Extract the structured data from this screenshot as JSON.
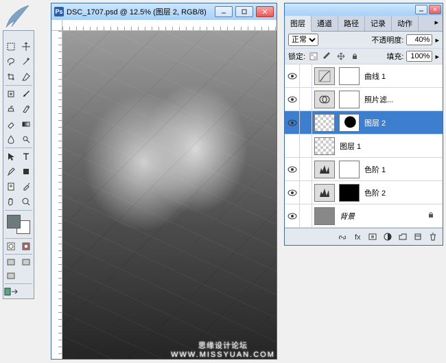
{
  "logo": {
    "alt": "feather"
  },
  "toolbox": {
    "tools": [
      "marquee",
      "move",
      "lasso",
      "magic-wand",
      "crop",
      "slice",
      "healing-brush",
      "brush",
      "clone-stamp",
      "history-brush",
      "eraser",
      "gradient",
      "blur",
      "dodge",
      "path-select",
      "type",
      "pen",
      "shape",
      "notes",
      "eyedropper",
      "hand",
      "zoom"
    ],
    "foreground": "#6e7b7c",
    "background": "#ffffff",
    "modes": [
      "standard",
      "quickmask"
    ],
    "screen_modes": [
      "normal",
      "full-menu",
      "full"
    ]
  },
  "document": {
    "title": "DSC_1707.psd @ 12.5% (图层 2, RGB/8)",
    "zoom": "12.5%"
  },
  "panel": {
    "tabs": [
      "图层",
      "通道",
      "路径",
      "记录",
      "动作"
    ],
    "active_tab": 0,
    "blend_mode": "正常",
    "opacity_label": "不透明度:",
    "opacity_value": "40%",
    "lock_label": "锁定:",
    "fill_label": "填充:",
    "fill_value": "100%",
    "layers": [
      {
        "visible": true,
        "type": "adjustment",
        "mask": "white",
        "name": "曲线 1",
        "sel": false,
        "icon": "curves"
      },
      {
        "visible": true,
        "type": "adjustment",
        "mask": "white",
        "name": "照片滤...",
        "sel": false,
        "icon": "photo-filter"
      },
      {
        "visible": true,
        "type": "pixel",
        "mask": "mixed",
        "name": "图层 2",
        "sel": true
      },
      {
        "visible": false,
        "type": "pixel",
        "mask": null,
        "name": "图层 1",
        "sel": false
      },
      {
        "visible": true,
        "type": "adjustment",
        "mask": "white",
        "name": "色阶 1",
        "sel": false,
        "icon": "levels"
      },
      {
        "visible": true,
        "type": "adjustment",
        "mask": "black",
        "name": "色阶 2",
        "sel": false,
        "icon": "levels"
      },
      {
        "visible": true,
        "type": "background",
        "mask": null,
        "name": "背景",
        "sel": false,
        "locked": true
      }
    ],
    "footer_buttons": [
      "link",
      "fx",
      "mask",
      "adjustment",
      "group",
      "new",
      "delete"
    ]
  },
  "watermark": {
    "text": "思缘设计论坛",
    "url": "WWW.MISSYUAN.COM"
  }
}
